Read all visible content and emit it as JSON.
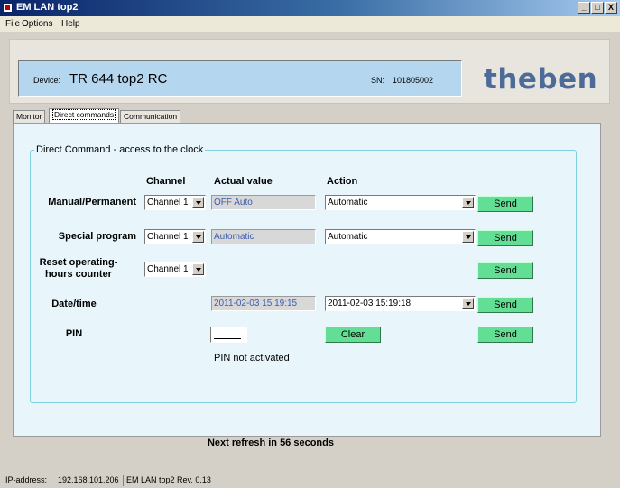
{
  "window": {
    "title": "EM LAN top2",
    "minimize": "_",
    "maximize": "□",
    "close": "X"
  },
  "menu": [
    "File",
    "Options",
    "Help"
  ],
  "header": {
    "device_label": "Device:",
    "device_value": "TR 644 top2 RC",
    "sn_label": "SN:",
    "sn_value": "101805002",
    "logo": "theben"
  },
  "tabs": [
    {
      "label": "Monitor"
    },
    {
      "label": "Direct commands",
      "active": true
    },
    {
      "label": "Communication"
    }
  ],
  "direct": {
    "group_title": "Direct Command - access to the clock",
    "col_channel": "Channel",
    "col_actual": "Actual value",
    "col_action": "Action",
    "rows": {
      "manual": {
        "label": "Manual/Permanent",
        "channel": "Channel 1",
        "actual": "OFF  Auto",
        "action": "Automatic",
        "send": "Send"
      },
      "special": {
        "label": "Special program",
        "channel": "Channel 1",
        "actual": "Automatic",
        "action": "Automatic",
        "send": "Send"
      },
      "reset": {
        "label_line1": "Reset operating-",
        "label_line2": "hours counter",
        "channel": "Channel 1",
        "send": "Send"
      },
      "datetime": {
        "label": "Date/time",
        "actual": "2011-02-03  15:19:15",
        "action": "2011-02-03  15:19:18",
        "send": "Send"
      },
      "pin": {
        "label": "PIN",
        "value": "",
        "clear": "Clear",
        "send": "Send",
        "status": "PIN not activated"
      }
    }
  },
  "refresh_text": "Next refresh in 56 seconds",
  "statusbar": {
    "ip_label": "IP-address:",
    "ip_value": "192.168.101.206",
    "version": "EM LAN top2 Rev.  0.13"
  },
  "colors": {
    "title_bar": "#0a246a",
    "device_box": "#b4d6ee",
    "panel_bg": "#e8f5fa",
    "group_border": "#7fcfe0",
    "button_green": "#62df95",
    "logo": "#4d6b99",
    "readonly_text": "#3b5ea8"
  }
}
